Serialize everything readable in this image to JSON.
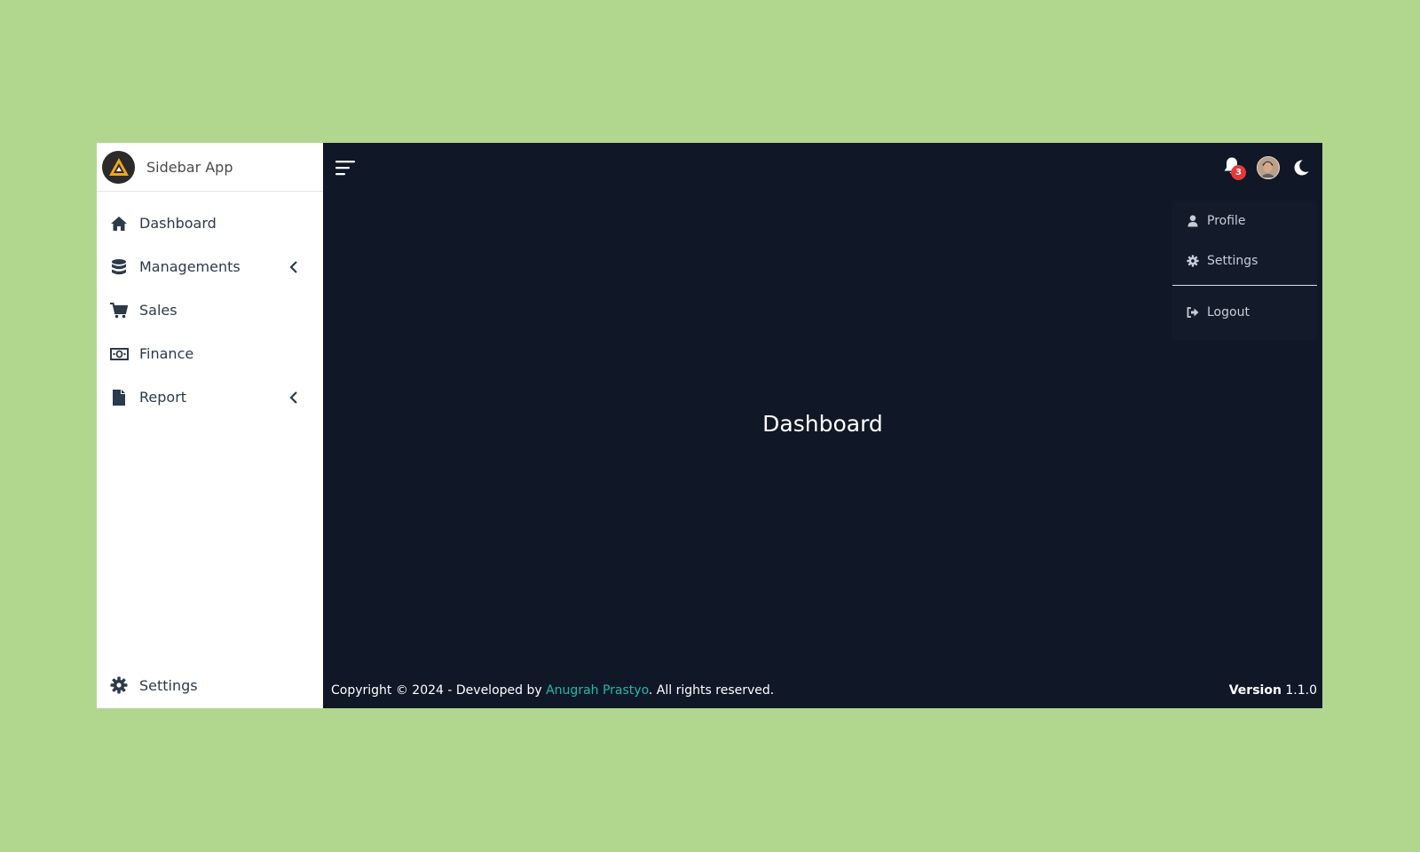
{
  "brand": {
    "name": "Sidebar App",
    "logo_icon": "triangle-logo"
  },
  "sidebar": {
    "items": [
      {
        "label": "Dashboard",
        "icon": "home-icon",
        "has_submenu": false
      },
      {
        "label": "Managements",
        "icon": "database-icon",
        "has_submenu": true
      },
      {
        "label": "Sales",
        "icon": "cart-icon",
        "has_submenu": false
      },
      {
        "label": "Finance",
        "icon": "money-icon",
        "has_submenu": false
      },
      {
        "label": "Report",
        "icon": "file-icon",
        "has_submenu": true
      }
    ],
    "footer": {
      "label": "Settings",
      "icon": "gear-icon"
    }
  },
  "topbar": {
    "notification_count": "3",
    "icons": [
      "hamburger-icon",
      "bell-icon",
      "avatar",
      "moon-icon"
    ]
  },
  "user_menu": {
    "items": [
      {
        "label": "Profile",
        "icon": "user-icon"
      },
      {
        "label": "Settings",
        "icon": "gear-icon"
      }
    ],
    "logout": {
      "label": "Logout",
      "icon": "sign-out-icon"
    }
  },
  "main": {
    "title": "Dashboard"
  },
  "footer": {
    "copyright_prefix": "Copyright © 2024 - Developed by ",
    "author": "Anugrah Prastyo",
    "copyright_suffix": ". All rights reserved.",
    "version_label": "Version",
    "version_value": "1.1.0"
  },
  "colors": {
    "page_background": "#b1d78f",
    "sidebar_background": "#ffffff",
    "main_background": "#101727",
    "accent": "#21b9a8",
    "badge": "#e53a3a"
  }
}
